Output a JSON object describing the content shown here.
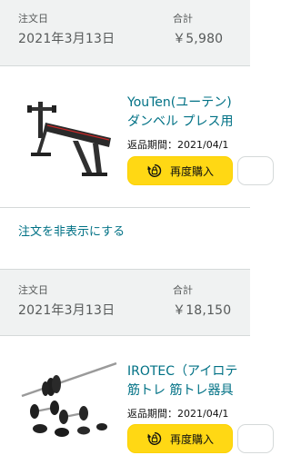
{
  "orders": [
    {
      "order_date_label": "注文日",
      "order_date": "2021年3月13日",
      "total_label": "合計",
      "total": "￥5,980",
      "product": {
        "title_line1": "YouTen(ユーテン)",
        "title_line2": "ダンベル プレス用",
        "return_period": "返品期間：2021/04/1",
        "image_icon": "incline-bench-icon"
      },
      "rebuy_label": "再度購入",
      "hide_order_label": "注文を非表示にする"
    },
    {
      "order_date_label": "注文日",
      "order_date": "2021年3月13日",
      "total_label": "合計",
      "total": "￥18,150",
      "product": {
        "title_line1": "IROTEC（アイロテ",
        "title_line2": "筋トレ 筋トレ器具",
        "return_period": "返品期間：2021/04/1",
        "image_icon": "barbell-dumbbell-set-icon"
      },
      "rebuy_label": "再度購入"
    }
  ],
  "colors": {
    "link": "#007185",
    "button_primary": "#ffd814",
    "header_bg": "#f0f2f2"
  }
}
